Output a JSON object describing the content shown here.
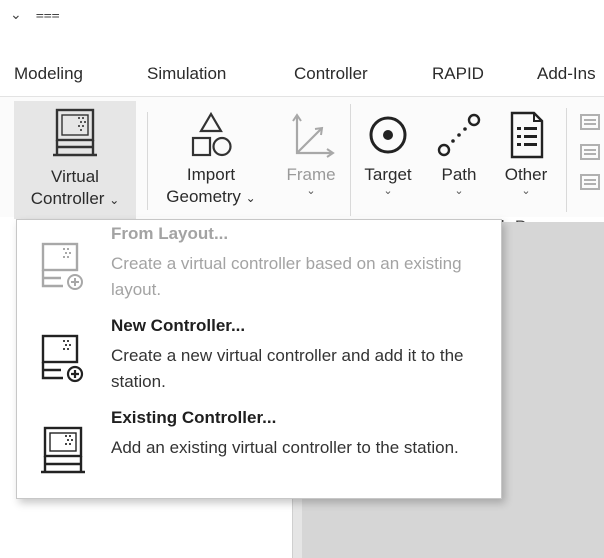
{
  "quick_access": {
    "dropdown_glyph": "⌄",
    "more_glyph": "⩶"
  },
  "tabs": [
    {
      "label": "Modeling"
    },
    {
      "label": "Simulation"
    },
    {
      "label": "Controller"
    },
    {
      "label": "RAPID"
    },
    {
      "label": "Add-Ins"
    }
  ],
  "ribbon": {
    "virtual_controller": {
      "line1": "Virtual",
      "line2": "Controller",
      "chevron": "⌄"
    },
    "import_geometry": {
      "line1": "Import",
      "line2": "Geometry",
      "chevron": "⌄"
    },
    "frame": {
      "label": "Frame",
      "chevron": "⌄"
    },
    "target": {
      "label": "Target",
      "chevron": "⌄"
    },
    "path": {
      "label": "Path",
      "chevron": "⌄"
    },
    "other": {
      "label": "Other",
      "chevron": "⌄"
    },
    "group_label": "th Progra"
  },
  "menu": {
    "items": [
      {
        "title": "From Layout...",
        "description": "Create a virtual controller based on an existing layout.",
        "enabled": false
      },
      {
        "title": "New Controller...",
        "description": "Create a new virtual controller and add it to the station.",
        "enabled": true
      },
      {
        "title": "Existing Controller...",
        "description": "Add an existing virtual controller to the station.",
        "enabled": true
      }
    ]
  },
  "colors": {
    "menu_border": "#c7c7c7",
    "pressed_button": "#e6e6e6",
    "disabled_text": "#a3a3a3",
    "workspace": "#d6d6d6"
  }
}
